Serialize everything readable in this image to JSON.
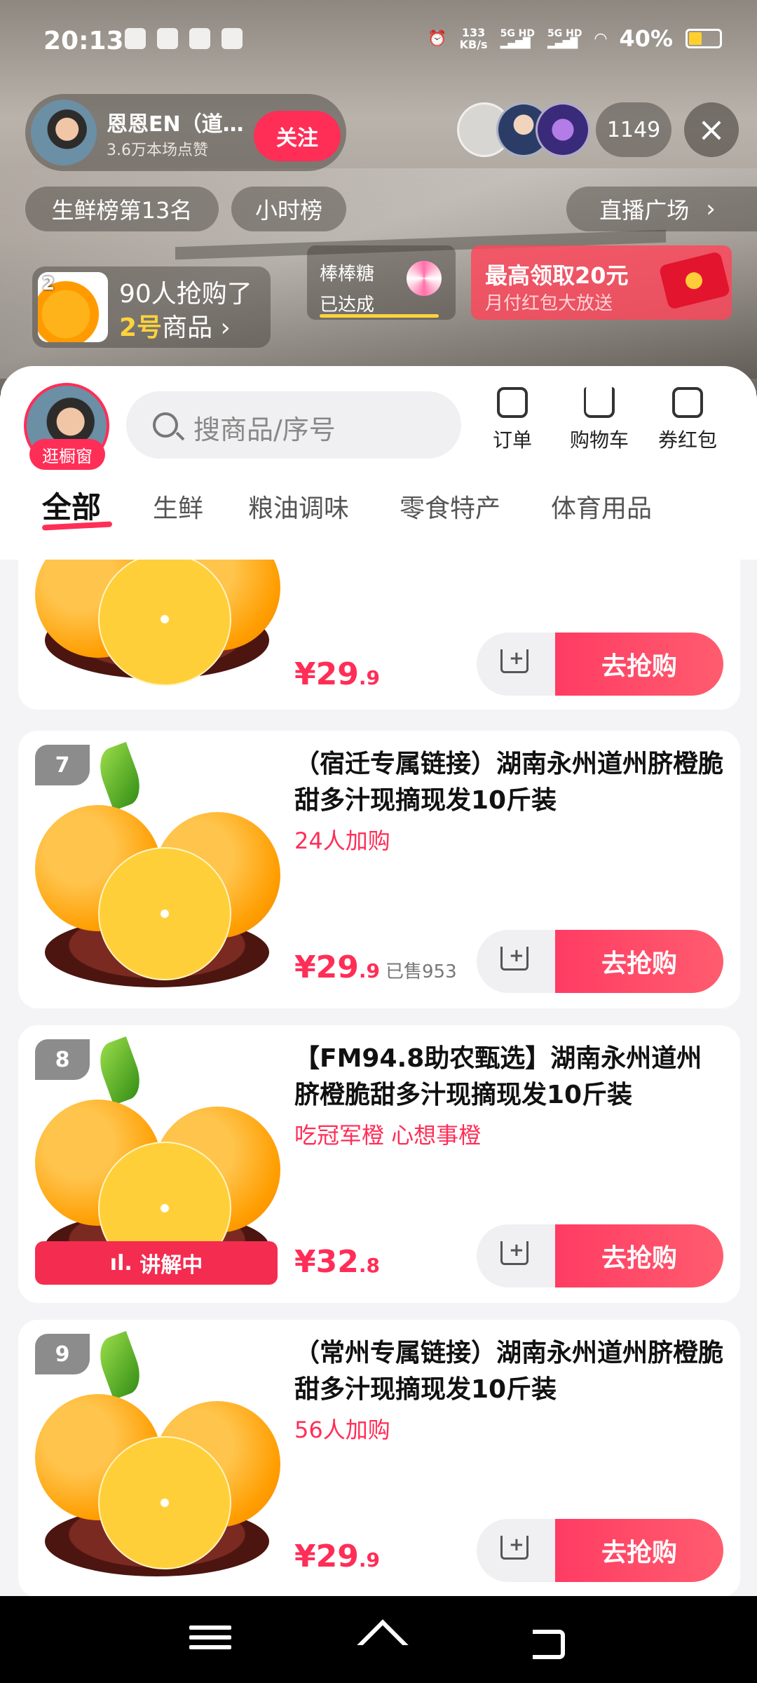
{
  "status_bar": {
    "time": "20:13",
    "net_speed_value": "133",
    "net_speed_unit": "KB/s",
    "signal1": "5G HD",
    "signal2": "5G HD",
    "battery": "40%"
  },
  "streamer": {
    "name": "恩恩EN（道…",
    "likes": "3.6万本场点赞",
    "follow_label": "关注",
    "viewer_count": "1149"
  },
  "chips": {
    "rank": "生鲜榜第13名",
    "hourly": "小时榜",
    "plaza": "直播广场"
  },
  "live_buy": {
    "thumb_num": "2",
    "line1": "90人抢购了",
    "line2_highlight": "2号",
    "line2_rest": "商品"
  },
  "candy": {
    "name": "棒棒糖",
    "status": "已达成"
  },
  "redpack": {
    "title": "最高领取20元",
    "subtitle": "月付红包大放送"
  },
  "shop": {
    "tag": "逛橱窗",
    "search_placeholder": "搜商品/序号",
    "tools": [
      "订单",
      "购物车",
      "券红包"
    ],
    "tabs": [
      "全部",
      "生鲜",
      "粮油调味",
      "零食特产",
      "体育用品"
    ]
  },
  "products": [
    {
      "price_main": "¥29",
      "price_dec": ".9",
      "buy_label": "去抢购"
    },
    {
      "index": "7",
      "title": "（宿迁专属链接）湖南永州道州脐橙脆甜多汁现摘现发10斤装",
      "sub": "24人加购",
      "price_main": "¥29",
      "price_dec": ".9",
      "sold": "已售953",
      "buy_label": "去抢购"
    },
    {
      "index": "8",
      "title": "【FM94.8助农甄选】湖南永州道州脐橙脆甜多汁现摘现发10斤装",
      "sub": "吃冠军橙 心想事橙",
      "price_main": "¥32",
      "price_dec": ".8",
      "explaining": "讲解中",
      "buy_label": "去抢购"
    },
    {
      "index": "9",
      "title": "（常州专属链接）湖南永州道州脐橙脆甜多汁现摘现发10斤装",
      "sub": "56人加购",
      "price_main": "¥29",
      "price_dec": ".9",
      "buy_label": "去抢购"
    }
  ],
  "icons": {
    "close": "×",
    "chevron": "›"
  }
}
